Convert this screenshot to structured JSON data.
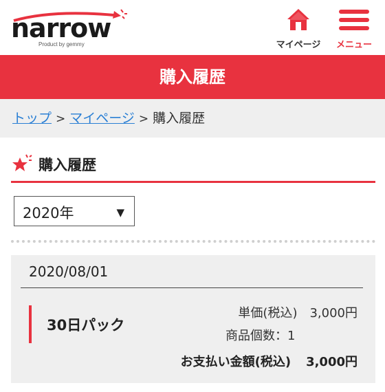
{
  "header": {
    "logo_text": "narrow",
    "logo_sub": "Product by gemmy",
    "mypage_label": "マイページ",
    "menu_label": "メニュー"
  },
  "page_title": "購入履歴",
  "breadcrumb": {
    "items": [
      "トップ",
      "マイページ",
      "購入履歴"
    ],
    "separator": ">"
  },
  "section": {
    "title": "購入履歴"
  },
  "year_select": {
    "value": "2020年",
    "arrow": "▼"
  },
  "order": {
    "date": "2020/08/01",
    "item_name": "30日パック",
    "unit_price_label": "単価(税込)",
    "unit_price": "3,000円",
    "quantity_label": "商品個数：",
    "quantity": "1",
    "total_label": "お支払い金額(税込)",
    "total": "3,000円"
  },
  "colors": {
    "accent": "#e8323f",
    "link": "#2a7fd4",
    "panel": "#efefef"
  }
}
